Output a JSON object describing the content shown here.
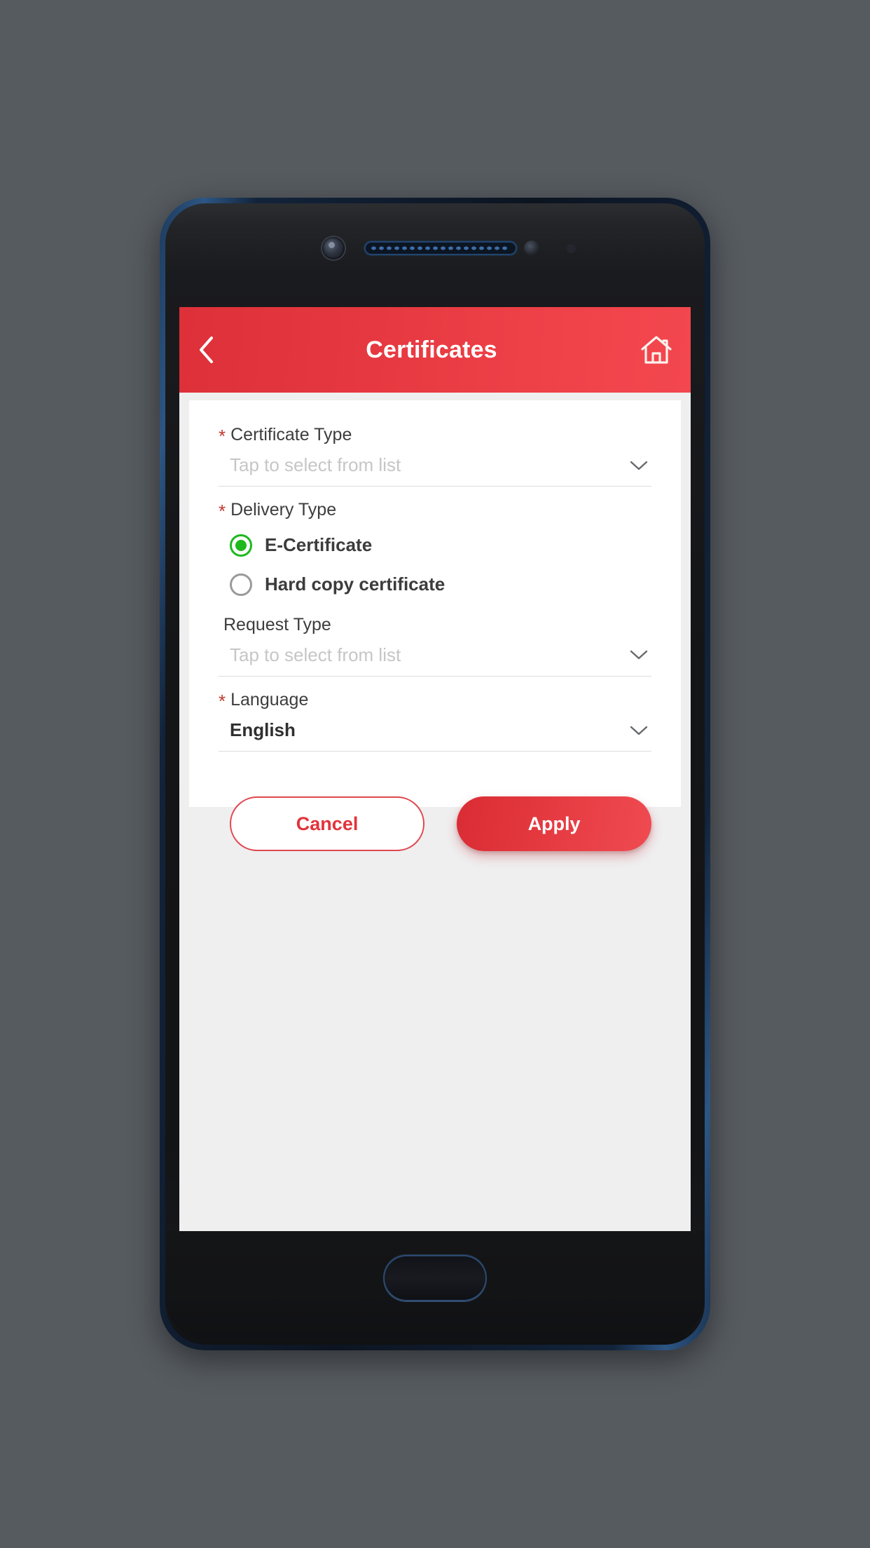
{
  "header": {
    "title": "Certificates",
    "back_icon": "chevron-left-icon",
    "home_icon": "home-icon",
    "background_color": "#e63840"
  },
  "form": {
    "certificate_type": {
      "label": "Certificate Type",
      "required": true,
      "required_marker": "*",
      "placeholder": "Tap to select from list",
      "value": "",
      "chevron_icon": "chevron-down-icon"
    },
    "delivery_type": {
      "label": "Delivery Type",
      "required": true,
      "required_marker": "*",
      "options": [
        {
          "label": "E-Certificate",
          "selected": true
        },
        {
          "label": "Hard copy certificate",
          "selected": false
        }
      ],
      "selected_color": "#1db91d"
    },
    "request_type": {
      "label": "Request Type",
      "required": false,
      "required_marker": "",
      "placeholder": "Tap to select from list",
      "value": "",
      "chevron_icon": "chevron-down-icon"
    },
    "language": {
      "label": "Language",
      "required": true,
      "required_marker": "*",
      "placeholder": "",
      "value": "English",
      "chevron_icon": "chevron-down-icon"
    }
  },
  "actions": {
    "cancel_label": "Cancel",
    "apply_label": "Apply",
    "accent_color": "#e2333b"
  }
}
